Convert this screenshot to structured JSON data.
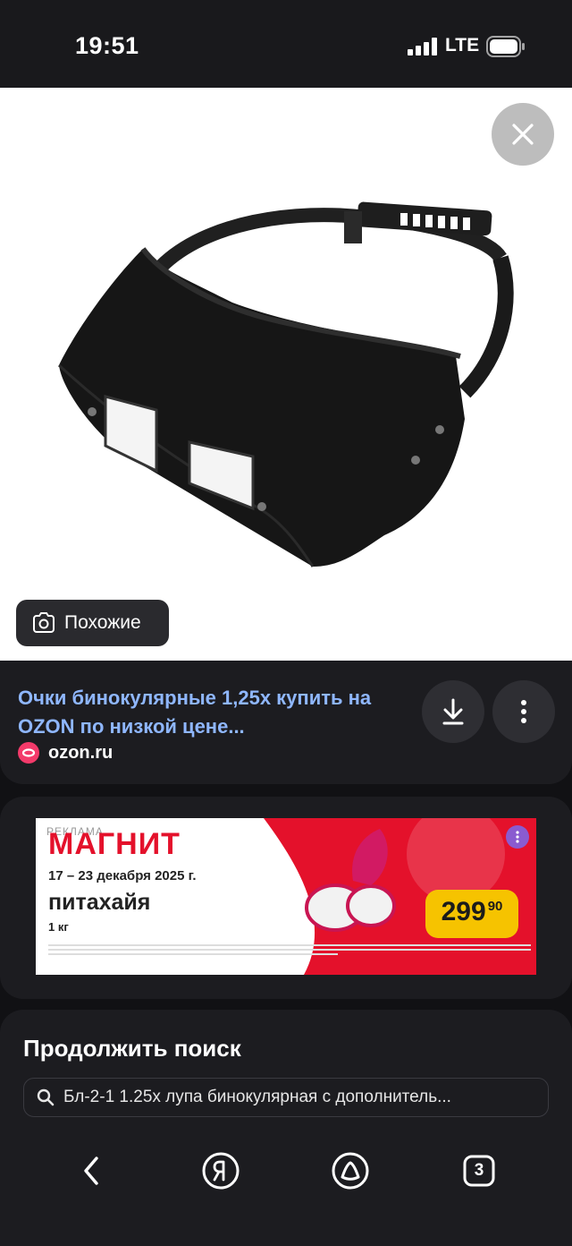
{
  "status": {
    "time": "19:51",
    "network": "LTE"
  },
  "image_viewer": {
    "similar_label": "Похожие",
    "close_icon": "close-icon"
  },
  "result": {
    "title": "Очки бинокулярные 1,25х купить на OZON по низкой цене...",
    "source": "ozon.ru"
  },
  "ad": {
    "label": "РЕКЛАМА",
    "brand": "МАГНИТ",
    "dates": "17 – 23 декабря 2025 г.",
    "product": "питахайя",
    "unit": "1 кг",
    "price_main": "299",
    "price_cents": "90",
    "colors": {
      "brand_red": "#e4112b",
      "price_yellow": "#f6c300"
    }
  },
  "continue_search": {
    "title": "Продолжить поиск",
    "query": "Бл-2-1 1.25х лупа бинокулярная с дополнитель..."
  },
  "navbar": {
    "tabs_count": "3"
  }
}
